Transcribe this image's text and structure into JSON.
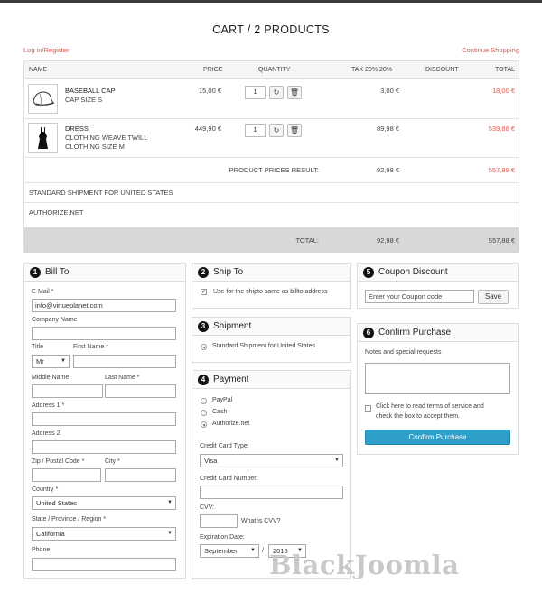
{
  "page": {
    "title": "CART / 2 PRODUCTS",
    "login_link": "Log in/Register",
    "continue_link": "Continue Shopping"
  },
  "cart": {
    "headers": {
      "name": "NAME",
      "price": "PRICE",
      "quantity": "QUANTITY",
      "tax": "TAX 20% 20%",
      "discount": "DISCOUNT",
      "total": "TOTAL"
    },
    "items": [
      {
        "name": "BASEBALL CAP",
        "detail1": "CAP SIZE S",
        "detail2": "",
        "price": "15,00 €",
        "qty": "1",
        "tax": "3,00 €",
        "total": "18,00 €",
        "icon": "cap-icon"
      },
      {
        "name": "DRESS",
        "detail1": "CLOTHING WEAVE TWILL",
        "detail2": "CLOTHING SIZE M",
        "price": "449,90 €",
        "qty": "1",
        "tax": "89,98 €",
        "total": "539,88 €",
        "icon": "dress-icon"
      }
    ],
    "result_label": "PRODUCT PRICES RESULT:",
    "result_tax": "92,98 €",
    "result_total": "557,88 €",
    "shipment_line": "STANDARD SHIPMENT FOR UNITED STATES",
    "payment_line": "AUTHORIZE.NET",
    "total_label": "TOTAL:",
    "total_tax": "92,98 €",
    "total_total": "557,88 €"
  },
  "bill": {
    "num": "1",
    "title": "Bill To",
    "email_label": "E-Mail *",
    "email_value": "info@virtueplanet.com",
    "company_label": "Company Name",
    "title_label": "Title",
    "title_value": "Mr",
    "first_label": "First Name *",
    "middle_label": "Middle Name",
    "last_label": "Last Name *",
    "addr1_label": "Address 1 *",
    "addr2_label": "Address 2",
    "zip_label": "Zip / Postal Code *",
    "city_label": "City *",
    "country_label": "Country *",
    "country_value": "United States",
    "state_label": "State / Province / Region *",
    "state_value": "California",
    "phone_label": "Phone"
  },
  "ship": {
    "num": "2",
    "title": "Ship To",
    "same_label": "Use for the shipto same as billto address"
  },
  "shipment": {
    "num": "3",
    "title": "Shipment",
    "option": "Standard Shipment for United States"
  },
  "payment": {
    "num": "4",
    "title": "Payment",
    "options": [
      "PayPal",
      "Cash",
      "Authorize.net"
    ],
    "cc_type_label": "Credit Card Type:",
    "cc_type_value": "Visa",
    "cc_number_label": "Credit Card Number:",
    "cvv_label": "CVV:",
    "cvv_help": "What is CVV?",
    "exp_label": "Expiration Date:",
    "exp_month": "September",
    "exp_sep": "/",
    "exp_year": "2015"
  },
  "coupon": {
    "num": "5",
    "title": "Coupon Discount",
    "placeholder": "Enter your Coupon code",
    "button": "Save"
  },
  "confirm": {
    "num": "6",
    "title": "Confirm Purchase",
    "notes_label": "Notes and special requests",
    "tos_line1": "Click here to read terms of service and",
    "tos_line2": "check the box to accept them.",
    "button": "Confirm Purchase"
  },
  "watermark": "BlackJoomla",
  "colors": {
    "accent_red": "#e05a4f",
    "button_blue": "#2e9fc9"
  }
}
